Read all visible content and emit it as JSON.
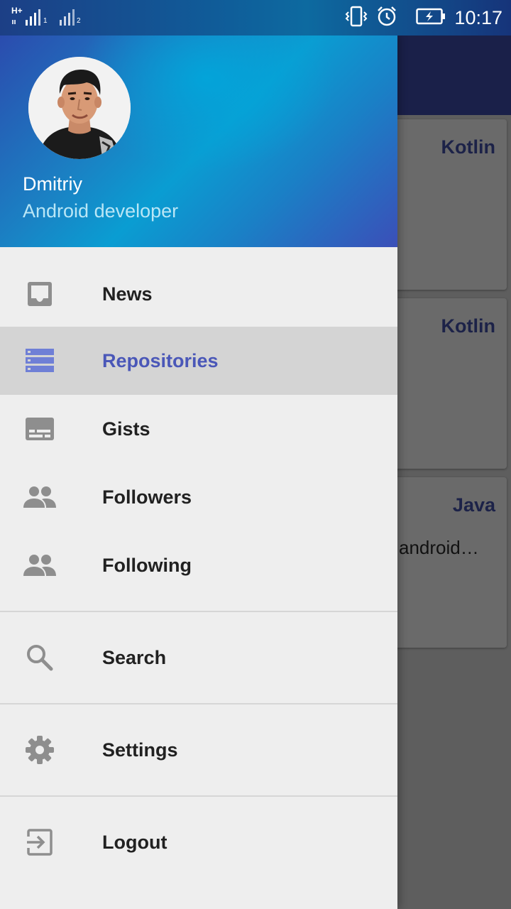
{
  "status_bar": {
    "network_type": "H+",
    "sim1": "1",
    "sim2": "2",
    "time": "10:17"
  },
  "drawer": {
    "user": {
      "name": "Dmitriy",
      "role": "Android developer"
    },
    "items": [
      {
        "label": "News",
        "icon": "inbox-icon",
        "active": false
      },
      {
        "label": "Repositories",
        "icon": "storage-icon",
        "active": true
      },
      {
        "label": "Gists",
        "icon": "subtitles-icon",
        "active": false
      },
      {
        "label": "Followers",
        "icon": "people-icon",
        "active": false
      },
      {
        "label": "Following",
        "icon": "people-icon",
        "active": false
      },
      {
        "label": "Search",
        "icon": "search-icon",
        "active": false
      },
      {
        "label": "Settings",
        "icon": "gear-icon",
        "active": false
      },
      {
        "label": "Logout",
        "icon": "exit-icon",
        "active": false
      }
    ]
  },
  "background_cards": [
    {
      "language": "Kotlin",
      "description": ""
    },
    {
      "language": "Kotlin",
      "description": ""
    },
    {
      "language": "Java",
      "description": "android…"
    }
  ],
  "colors": {
    "accent": "#4a57b8",
    "toolbar": "#1a2049",
    "icon": "#8e8e8e",
    "active_icon": "#6f7fd6"
  }
}
